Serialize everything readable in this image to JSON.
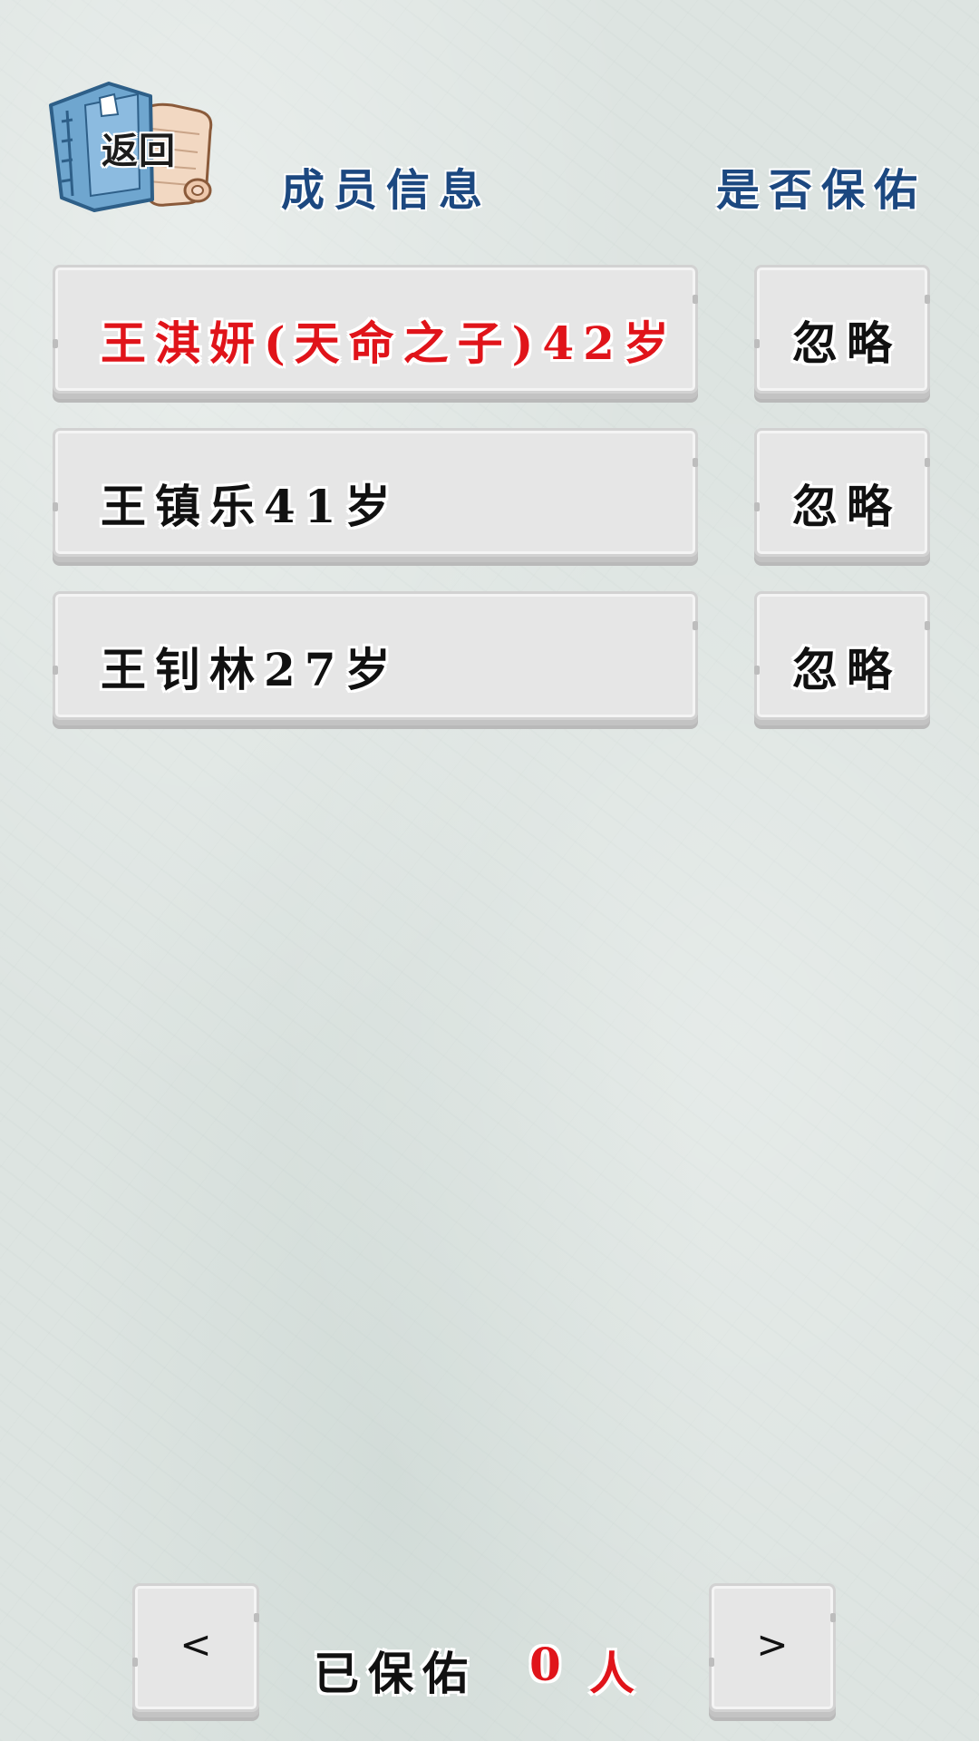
{
  "back_button": {
    "label": "返回",
    "icon": "book-scroll-icon"
  },
  "headers": {
    "members": "成员信息",
    "protect": "是否保佑"
  },
  "members": [
    {
      "name": "王淇妍(天命之子)42岁",
      "color": "#e0141a",
      "action": "忽略"
    },
    {
      "name": "王镇乐41岁",
      "color": "#111111",
      "action": "忽略"
    },
    {
      "name": "王钊林27岁",
      "color": "#111111",
      "action": "忽略"
    }
  ],
  "footer": {
    "prev": "<",
    "next": ">",
    "protected_label": "已保佑",
    "protected_count": "0",
    "protected_unit": "人"
  },
  "colors": {
    "header_blue": "#1c4880",
    "highlight_red": "#e0141a",
    "panel_bg": "#e6e6e6",
    "paper_bg": "#dde4e1"
  }
}
